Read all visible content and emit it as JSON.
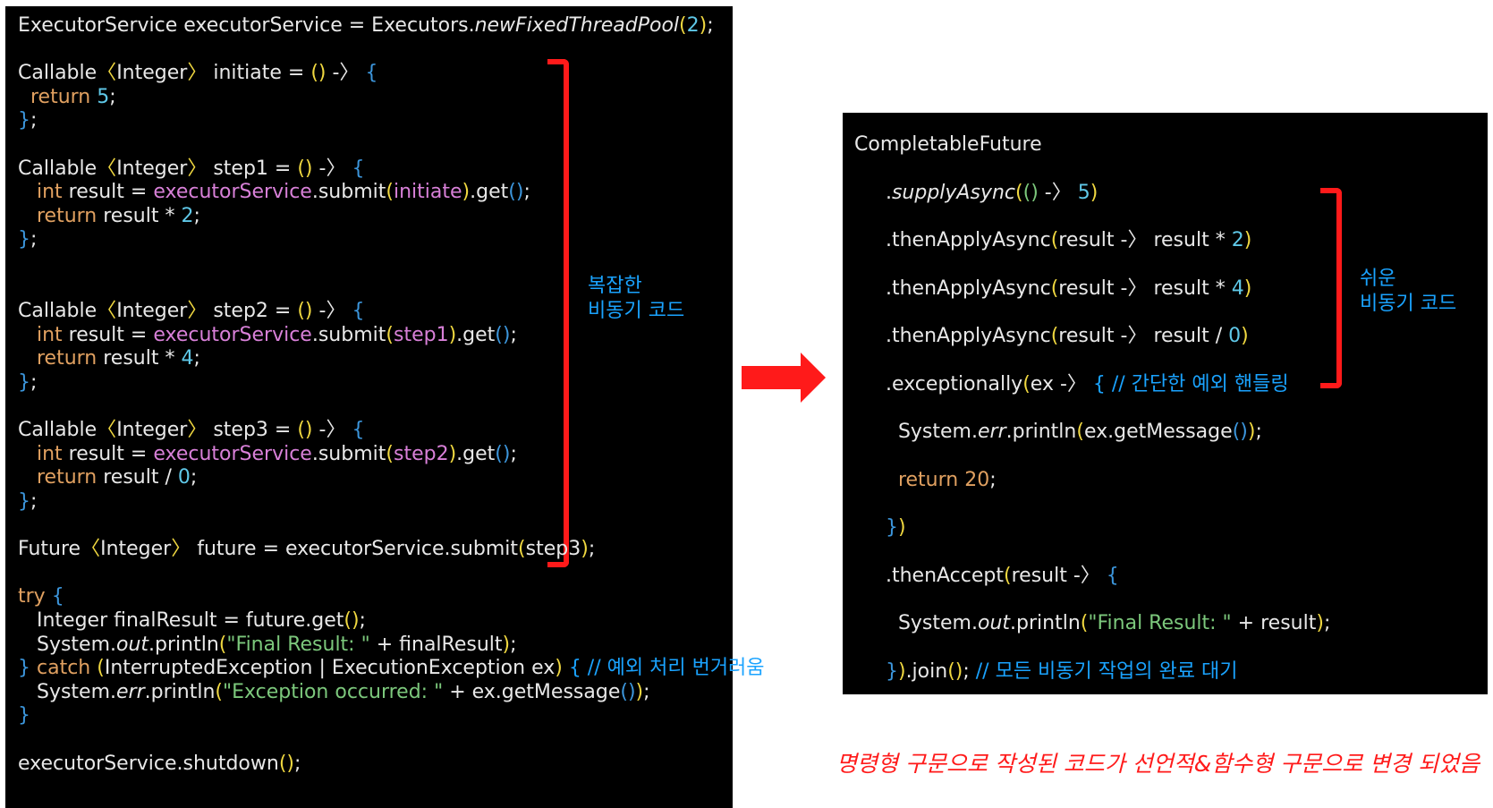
{
  "colors": {
    "background": "#ffffff",
    "panel": "#000000",
    "code_default": "#e8e8e8",
    "keyword": "#e0a060",
    "number": "#5fc8e8",
    "bracket_brace": "#f0d840",
    "paren_inner": "#3c96dc",
    "string": "#7cc87c",
    "instance_field": "#d880d8",
    "comment": "#1aa3ff",
    "highlight_red": "#ff1a1a"
  },
  "left_code": [
    [
      {
        "t": "ExecutorService executorService = Executors.",
        "c": "code_default"
      },
      {
        "t": "newFixedThreadPool",
        "c": "code_default",
        "i": true
      },
      {
        "t": "(",
        "c": "bracket_brace"
      },
      {
        "t": "2",
        "c": "number"
      },
      {
        "t": ")",
        "c": "bracket_brace"
      },
      {
        "t": ";",
        "c": "code_default"
      }
    ],
    [],
    [
      {
        "t": "Callable",
        "c": "code_default"
      },
      {
        "t": "〈",
        "c": "bracket_brace"
      },
      {
        "t": "Integer",
        "c": "code_default"
      },
      {
        "t": "〉",
        "c": "bracket_brace"
      },
      {
        "t": " initiate = ",
        "c": "code_default"
      },
      {
        "t": "()",
        "c": "bracket_brace"
      },
      {
        "t": " -〉 ",
        "c": "code_default"
      },
      {
        "t": "{",
        "c": "paren_inner"
      }
    ],
    [
      {
        "t": "  return ",
        "c": "keyword"
      },
      {
        "t": "5",
        "c": "number"
      },
      {
        "t": ";",
        "c": "code_default"
      }
    ],
    [
      {
        "t": "}",
        "c": "paren_inner"
      },
      {
        "t": ";",
        "c": "code_default"
      }
    ],
    [],
    [
      {
        "t": "Callable",
        "c": "code_default"
      },
      {
        "t": "〈",
        "c": "bracket_brace"
      },
      {
        "t": "Integer",
        "c": "code_default"
      },
      {
        "t": "〉",
        "c": "bracket_brace"
      },
      {
        "t": " step1 = ",
        "c": "code_default"
      },
      {
        "t": "()",
        "c": "bracket_brace"
      },
      {
        "t": " -〉 ",
        "c": "code_default"
      },
      {
        "t": "{",
        "c": "paren_inner"
      }
    ],
    [
      {
        "t": "   int",
        "c": "keyword"
      },
      {
        "t": " result = ",
        "c": "code_default"
      },
      {
        "t": "executorService",
        "c": "instance_field"
      },
      {
        "t": ".submit",
        "c": "code_default"
      },
      {
        "t": "(",
        "c": "bracket_brace"
      },
      {
        "t": "initiate",
        "c": "instance_field"
      },
      {
        "t": ")",
        "c": "bracket_brace"
      },
      {
        "t": ".get",
        "c": "code_default"
      },
      {
        "t": "()",
        "c": "paren_inner"
      },
      {
        "t": ";",
        "c": "code_default"
      }
    ],
    [
      {
        "t": "   return",
        "c": "keyword"
      },
      {
        "t": " result * ",
        "c": "code_default"
      },
      {
        "t": "2",
        "c": "number"
      },
      {
        "t": ";",
        "c": "code_default"
      }
    ],
    [
      {
        "t": "}",
        "c": "paren_inner"
      },
      {
        "t": ";",
        "c": "code_default"
      }
    ],
    [],
    [],
    [
      {
        "t": "Callable",
        "c": "code_default"
      },
      {
        "t": "〈",
        "c": "bracket_brace"
      },
      {
        "t": "Integer",
        "c": "code_default"
      },
      {
        "t": "〉",
        "c": "bracket_brace"
      },
      {
        "t": " step2 = ",
        "c": "code_default"
      },
      {
        "t": "()",
        "c": "bracket_brace"
      },
      {
        "t": " -〉 ",
        "c": "code_default"
      },
      {
        "t": "{",
        "c": "paren_inner"
      }
    ],
    [
      {
        "t": "   int",
        "c": "keyword"
      },
      {
        "t": " result = ",
        "c": "code_default"
      },
      {
        "t": "executorService",
        "c": "instance_field"
      },
      {
        "t": ".submit",
        "c": "code_default"
      },
      {
        "t": "(",
        "c": "bracket_brace"
      },
      {
        "t": "step1",
        "c": "instance_field"
      },
      {
        "t": ")",
        "c": "bracket_brace"
      },
      {
        "t": ".get",
        "c": "code_default"
      },
      {
        "t": "()",
        "c": "paren_inner"
      },
      {
        "t": ";",
        "c": "code_default"
      }
    ],
    [
      {
        "t": "   return",
        "c": "keyword"
      },
      {
        "t": " result * ",
        "c": "code_default"
      },
      {
        "t": "4",
        "c": "number"
      },
      {
        "t": ";",
        "c": "code_default"
      }
    ],
    [
      {
        "t": "}",
        "c": "paren_inner"
      },
      {
        "t": ";",
        "c": "code_default"
      }
    ],
    [],
    [
      {
        "t": "Callable",
        "c": "code_default"
      },
      {
        "t": "〈",
        "c": "bracket_brace"
      },
      {
        "t": "Integer",
        "c": "code_default"
      },
      {
        "t": "〉",
        "c": "bracket_brace"
      },
      {
        "t": " step3 = ",
        "c": "code_default"
      },
      {
        "t": "()",
        "c": "bracket_brace"
      },
      {
        "t": " -〉 ",
        "c": "code_default"
      },
      {
        "t": "{",
        "c": "paren_inner"
      }
    ],
    [
      {
        "t": "   int",
        "c": "keyword"
      },
      {
        "t": " result = ",
        "c": "code_default"
      },
      {
        "t": "executorService",
        "c": "instance_field"
      },
      {
        "t": ".submit",
        "c": "code_default"
      },
      {
        "t": "(",
        "c": "bracket_brace"
      },
      {
        "t": "step2",
        "c": "instance_field"
      },
      {
        "t": ")",
        "c": "bracket_brace"
      },
      {
        "t": ".get",
        "c": "code_default"
      },
      {
        "t": "()",
        "c": "paren_inner"
      },
      {
        "t": ";",
        "c": "code_default"
      }
    ],
    [
      {
        "t": "   return",
        "c": "keyword"
      },
      {
        "t": " result / ",
        "c": "code_default"
      },
      {
        "t": "0",
        "c": "number"
      },
      {
        "t": ";",
        "c": "code_default"
      }
    ],
    [
      {
        "t": "}",
        "c": "paren_inner"
      },
      {
        "t": ";",
        "c": "code_default"
      }
    ],
    [],
    [
      {
        "t": "Future",
        "c": "code_default"
      },
      {
        "t": "〈",
        "c": "bracket_brace"
      },
      {
        "t": "Integer",
        "c": "code_default"
      },
      {
        "t": "〉",
        "c": "bracket_brace"
      },
      {
        "t": " future = executorService.submit",
        "c": "code_default"
      },
      {
        "t": "(",
        "c": "bracket_brace"
      },
      {
        "t": "step3",
        "c": "code_default"
      },
      {
        "t": ")",
        "c": "bracket_brace"
      },
      {
        "t": ";",
        "c": "code_default"
      }
    ],
    [],
    [
      {
        "t": "try ",
        "c": "keyword"
      },
      {
        "t": "{",
        "c": "paren_inner"
      }
    ],
    [
      {
        "t": "   Integer finalResult = future.get",
        "c": "code_default"
      },
      {
        "t": "()",
        "c": "bracket_brace"
      },
      {
        "t": ";",
        "c": "code_default"
      }
    ],
    [
      {
        "t": "   System.",
        "c": "code_default"
      },
      {
        "t": "out",
        "c": "code_default",
        "i": true
      },
      {
        "t": ".println",
        "c": "code_default"
      },
      {
        "t": "(",
        "c": "bracket_brace"
      },
      {
        "t": "\"Final Result: \"",
        "c": "string"
      },
      {
        "t": " + finalResult",
        "c": "code_default"
      },
      {
        "t": ")",
        "c": "bracket_brace"
      },
      {
        "t": ";",
        "c": "code_default"
      }
    ],
    [
      {
        "t": "} ",
        "c": "paren_inner"
      },
      {
        "t": "catch ",
        "c": "keyword"
      },
      {
        "t": "(",
        "c": "bracket_brace"
      },
      {
        "t": "InterruptedException | ExecutionException ex",
        "c": "code_default"
      },
      {
        "t": ")",
        "c": "bracket_brace"
      },
      {
        "t": " { // 예외 처리 번거러움",
        "c": "comment"
      }
    ],
    [
      {
        "t": "   System.",
        "c": "code_default"
      },
      {
        "t": "err",
        "c": "code_default",
        "i": true
      },
      {
        "t": ".println",
        "c": "code_default"
      },
      {
        "t": "(",
        "c": "bracket_brace"
      },
      {
        "t": "\"Exception occurred: \"",
        "c": "string"
      },
      {
        "t": " + ex.getMessage",
        "c": "code_default"
      },
      {
        "t": "()",
        "c": "paren_inner"
      },
      {
        "t": ")",
        "c": "bracket_brace"
      },
      {
        "t": ";",
        "c": "code_default"
      }
    ],
    [
      {
        "t": "}",
        "c": "paren_inner"
      }
    ],
    [],
    [
      {
        "t": "executorService.shutdown",
        "c": "code_default"
      },
      {
        "t": "()",
        "c": "bracket_brace"
      },
      {
        "t": ";",
        "c": "code_default"
      }
    ]
  ],
  "right_code": [
    [
      {
        "t": "CompletableFuture",
        "c": "code_default"
      }
    ],
    [
      {
        "t": "     .",
        "c": "code_default"
      },
      {
        "t": "supplyAsync",
        "c": "code_default",
        "i": true
      },
      {
        "t": "(",
        "c": "bracket_brace"
      },
      {
        "t": "()",
        "c": "string"
      },
      {
        "t": " -〉 ",
        "c": "code_default"
      },
      {
        "t": "5",
        "c": "number"
      },
      {
        "t": ")",
        "c": "bracket_brace"
      }
    ],
    [
      {
        "t": "     .thenApplyAsync",
        "c": "code_default"
      },
      {
        "t": "(",
        "c": "bracket_brace"
      },
      {
        "t": "result -〉 result * ",
        "c": "code_default"
      },
      {
        "t": "2",
        "c": "number"
      },
      {
        "t": ")",
        "c": "bracket_brace"
      }
    ],
    [
      {
        "t": "     .thenApplyAsync",
        "c": "code_default"
      },
      {
        "t": "(",
        "c": "bracket_brace"
      },
      {
        "t": "result -〉 result * ",
        "c": "code_default"
      },
      {
        "t": "4",
        "c": "number"
      },
      {
        "t": ")",
        "c": "bracket_brace"
      }
    ],
    [
      {
        "t": "     .thenApplyAsync",
        "c": "code_default"
      },
      {
        "t": "(",
        "c": "bracket_brace"
      },
      {
        "t": "result -〉 result / ",
        "c": "code_default"
      },
      {
        "t": "0",
        "c": "number"
      },
      {
        "t": ")",
        "c": "bracket_brace"
      }
    ],
    [
      {
        "t": "     .exceptionally",
        "c": "code_default"
      },
      {
        "t": "(",
        "c": "bracket_brace"
      },
      {
        "t": "ex -〉 ",
        "c": "code_default"
      },
      {
        "t": "{ // 간단한 예외 핸들링",
        "c": "comment"
      }
    ],
    [
      {
        "t": "       System.",
        "c": "code_default"
      },
      {
        "t": "err",
        "c": "code_default",
        "i": true
      },
      {
        "t": ".println",
        "c": "code_default"
      },
      {
        "t": "(",
        "c": "bracket_brace"
      },
      {
        "t": "ex.getMessage",
        "c": "code_default"
      },
      {
        "t": "()",
        "c": "paren_inner"
      },
      {
        "t": ")",
        "c": "bracket_brace"
      },
      {
        "t": ";",
        "c": "code_default"
      }
    ],
    [
      {
        "t": "       return ",
        "c": "keyword"
      },
      {
        "t": "20",
        "c": "keyword"
      },
      {
        "t": ";",
        "c": "code_default"
      }
    ],
    [
      {
        "t": "     }",
        "c": "paren_inner"
      },
      {
        "t": ")",
        "c": "bracket_brace"
      }
    ],
    [
      {
        "t": "     .thenAccept",
        "c": "code_default"
      },
      {
        "t": "(",
        "c": "bracket_brace"
      },
      {
        "t": "result -〉 ",
        "c": "code_default"
      },
      {
        "t": "{",
        "c": "paren_inner"
      }
    ],
    [
      {
        "t": "       System.",
        "c": "code_default"
      },
      {
        "t": "out",
        "c": "code_default",
        "i": true
      },
      {
        "t": ".println",
        "c": "code_default"
      },
      {
        "t": "(",
        "c": "bracket_brace"
      },
      {
        "t": "\"Final Result: \"",
        "c": "string"
      },
      {
        "t": " + result",
        "c": "code_default"
      },
      {
        "t": ")",
        "c": "bracket_brace"
      },
      {
        "t": ";",
        "c": "code_default"
      }
    ],
    [
      {
        "t": "     }",
        "c": "paren_inner"
      },
      {
        "t": ")",
        "c": "bracket_brace"
      },
      {
        "t": ".join",
        "c": "code_default"
      },
      {
        "t": "()",
        "c": "bracket_brace"
      },
      {
        "t": "; ",
        "c": "code_default"
      },
      {
        "t": "// 모든 비동기 작업의 완료 대기",
        "c": "comment"
      }
    ]
  ],
  "left_annotation": "복잡한\n비동기 코드",
  "right_annotation": "쉬운\n비동기 코드",
  "caption": "명령형 구문으로 작성된 코드가 선언적&함수형 구문으로 변경 되었음",
  "arrow_icon": "right-arrow-icon"
}
